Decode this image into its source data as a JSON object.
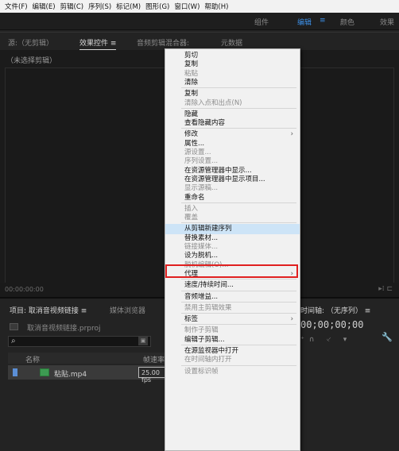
{
  "menubar": [
    "文件(F)",
    "编辑(E)",
    "剪辑(C)",
    "序列(S)",
    "标记(M)",
    "图形(G)",
    "窗口(W)",
    "帮助(H)"
  ],
  "workspace": {
    "items": [
      "组件",
      "编辑",
      "颜色",
      "效果"
    ],
    "active": "编辑",
    "menu_glyph": "≡"
  },
  "source_panel": {
    "tabs": [
      "源:（无剪辑）",
      "效果控件",
      "音频剪辑混合器:",
      "元数据"
    ],
    "active_tab": "效果控件",
    "tab_menu_glyph": "≡",
    "no_clip": "（未选择剪辑）",
    "timecode": "00:00:00:00"
  },
  "project": {
    "tab_label": "项目: 取消音视频链接",
    "tab_menu_glyph": "≡",
    "media_tab": "媒体浏览器",
    "file_name": "取消音视频链接.prproj",
    "search_placeholder": "",
    "columns": {
      "name": "名称",
      "rate": "帧速率"
    },
    "row": {
      "name": "粘贴.mp4",
      "rate": "25.00 fps"
    }
  },
  "timeline": {
    "tab_label": "时间轴: （无序列）",
    "tab_menu_glyph": "≡",
    "timecode": "00;00;00;00"
  },
  "context_menu": {
    "items": [
      {
        "label": "剪切",
        "enabled": true
      },
      {
        "label": "复制",
        "enabled": true
      },
      {
        "label": "粘贴",
        "enabled": false
      },
      {
        "label": "清除",
        "enabled": true
      },
      {
        "sep": true
      },
      {
        "label": "复制",
        "enabled": true
      },
      {
        "label": "清除入点和出点(N)",
        "enabled": false
      },
      {
        "sep": true
      },
      {
        "label": "隐藏",
        "enabled": true
      },
      {
        "label": "查看隐藏内容",
        "enabled": true
      },
      {
        "sep": true
      },
      {
        "label": "修改",
        "enabled": true,
        "submenu": true
      },
      {
        "label": "属性...",
        "enabled": true
      },
      {
        "label": "源设置...",
        "enabled": false
      },
      {
        "label": "序列设置...",
        "enabled": false
      },
      {
        "label": "在资源管理器中显示...",
        "enabled": true
      },
      {
        "label": "在资源管理器中显示项目...",
        "enabled": true
      },
      {
        "label": "显示源稿...",
        "enabled": false
      },
      {
        "label": "重命名",
        "enabled": true
      },
      {
        "sep": true
      },
      {
        "label": "插入",
        "enabled": false
      },
      {
        "label": "覆盖",
        "enabled": false
      },
      {
        "sep": true
      },
      {
        "label": "从剪辑新建序列",
        "enabled": true,
        "highlighted": true
      },
      {
        "label": "替换素材...",
        "enabled": true
      },
      {
        "label": "链接媒体...",
        "enabled": false
      },
      {
        "label": "设为脱机...",
        "enabled": true
      },
      {
        "label": "脱机编辑(O)...",
        "enabled": false
      },
      {
        "label": "代理",
        "enabled": true,
        "submenu": true
      },
      {
        "sep": true
      },
      {
        "label": "速度/持续时间...",
        "enabled": true
      },
      {
        "sep": true
      },
      {
        "label": "音频增益...",
        "enabled": true
      },
      {
        "sep": true
      },
      {
        "label": "禁用主剪辑效果",
        "enabled": false
      },
      {
        "sep": true
      },
      {
        "label": "标签",
        "enabled": true,
        "submenu": true
      },
      {
        "sep": true
      },
      {
        "label": "制作子剪辑",
        "enabled": false
      },
      {
        "label": "编辑子剪辑...",
        "enabled": true
      },
      {
        "sep": true
      },
      {
        "label": "在源监视器中打开",
        "enabled": true
      },
      {
        "label": "在时间轴内打开",
        "enabled": false
      },
      {
        "sep": true
      },
      {
        "label": "设置标识帧",
        "enabled": false
      }
    ],
    "submenu_glyph": "›"
  },
  "colors": {
    "accent": "#3c8fe6",
    "highlight_box": "#e02020",
    "menu_highlight": "#cde4f7",
    "clip_label": "#5b8fd6"
  }
}
